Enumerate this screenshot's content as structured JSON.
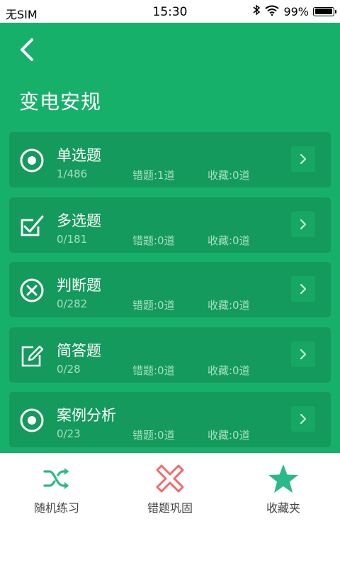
{
  "status_bar": {
    "carrier": "无SIM",
    "time": "15:30",
    "battery": "99%",
    "battery_level": 0.99
  },
  "header": {
    "back_icon": "chevron-left-icon",
    "title": "变电安规"
  },
  "cards": [
    {
      "icon": "radio-circle-icon",
      "title": "单选题",
      "progress": "1/486",
      "wrong": "错题:1道",
      "favorite": "收藏:0道"
    },
    {
      "icon": "checkbox-icon",
      "title": "多选题",
      "progress": "0/181",
      "wrong": "错题:0道",
      "favorite": "收藏:0道"
    },
    {
      "icon": "circle-x-icon",
      "title": "判断题",
      "progress": "0/282",
      "wrong": "错题:0道",
      "favorite": "收藏:0道"
    },
    {
      "icon": "edit-pencil-icon",
      "title": "简答题",
      "progress": "0/28",
      "wrong": "错题:0道",
      "favorite": "收藏:0道"
    },
    {
      "icon": "radio-circle-icon",
      "title": "案例分析",
      "progress": "0/23",
      "wrong": "错题:0道",
      "favorite": "收藏:0道"
    }
  ],
  "tab_bar": {
    "items": [
      {
        "label": "随机练习",
        "icon": "shuffle-icon",
        "color": "#2bb98a"
      },
      {
        "label": "错题巩固",
        "icon": "x-mark-icon",
        "color": "#f06b6b"
      },
      {
        "label": "收藏夹",
        "icon": "star-icon",
        "color": "#2bb98a"
      }
    ]
  },
  "colors": {
    "primary": "#17b06a",
    "card": "#149a5d",
    "stat_text": "#a8dfc2"
  }
}
